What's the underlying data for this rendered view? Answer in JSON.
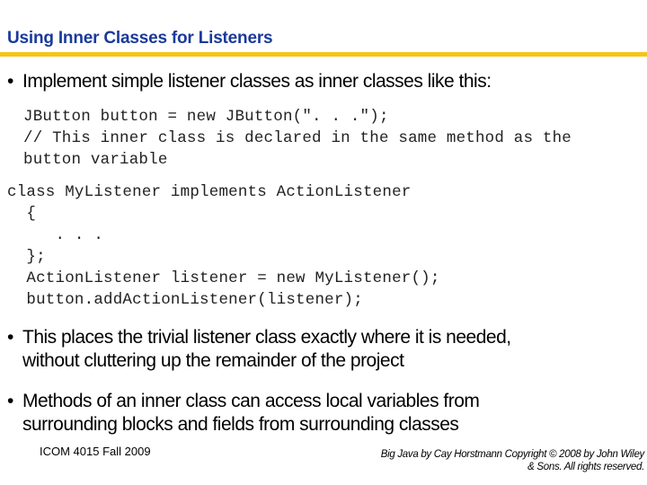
{
  "slide": {
    "title": "Using Inner Classes for Listeners",
    "accent_colors": {
      "title": "#1a3a9a",
      "rule": "#f5c518"
    },
    "bullets": [
      {
        "marker": "•",
        "lines": [
          "Implement simple listener classes as inner classes like this:"
        ]
      },
      {
        "marker": "•",
        "lines": [
          "This places the trivial listener class exactly where it is needed,",
          "without cluttering up the remainder of the project"
        ]
      },
      {
        "marker": "•",
        "lines": [
          "Methods of an inner class can access local variables from",
          "surrounding blocks and fields from surrounding classes"
        ]
      }
    ],
    "code_block_1": [
      "JButton button = new JButton(\". . .\");",
      "// This inner class is declared in the same method as the",
      "button variable"
    ],
    "code_block_2": [
      "class MyListener implements ActionListener",
      "  {",
      "     . . .",
      "  };",
      "  ActionListener listener = new MyListener();",
      "  button.addActionListener(listener);"
    ],
    "footer": {
      "left": "ICOM 4015 Fall 2009",
      "right_line1": "Big Java by Cay Horstmann Copyright © 2008 by John Wiley",
      "right_line2": "& Sons.  All rights reserved."
    }
  }
}
